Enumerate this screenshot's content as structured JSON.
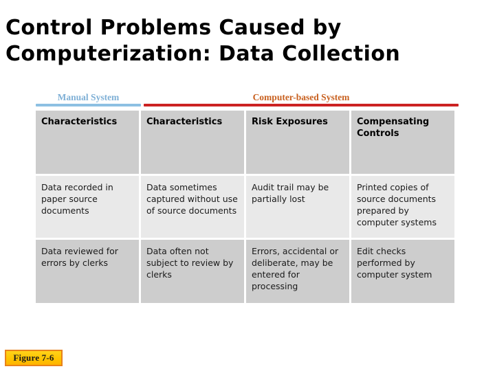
{
  "slide": {
    "title_line1": "Control Problems Caused by",
    "title_line2": "Computerization: Data Collection",
    "figure_label": "Figure 7-6"
  },
  "colors": {
    "manual_text": "#7fb0d6",
    "manual_rule": "#8dc0e2",
    "computer_text": "#c8601f",
    "computer_rule": "#cc2222",
    "header_cell_bg": "#cdcdcd",
    "body_row_light_bg": "#e9e9e9",
    "body_row_dark_bg": "#cdcdcd",
    "badge_border": "#e8821a",
    "badge_fill": "#ffc400"
  },
  "section_headers": [
    {
      "label": "Manual System",
      "spans_columns": 1
    },
    {
      "label": "Computer-based System",
      "spans_columns": 3
    }
  ],
  "table": {
    "columns": [
      "Characteristics",
      "Characteristics",
      "Risk Exposures",
      "Compensating Controls"
    ],
    "rows": [
      [
        "Data recorded in paper source documents",
        "Data sometimes captured without use of source documents",
        "Audit trail may be partially lost",
        "Printed copies of source documents prepared by computer systems"
      ],
      [
        "Data reviewed for errors by clerks",
        "Data often not subject to review by clerks",
        "Errors, accidental or deliberate, may be entered for processing",
        "Edit checks performed by computer system"
      ]
    ]
  }
}
